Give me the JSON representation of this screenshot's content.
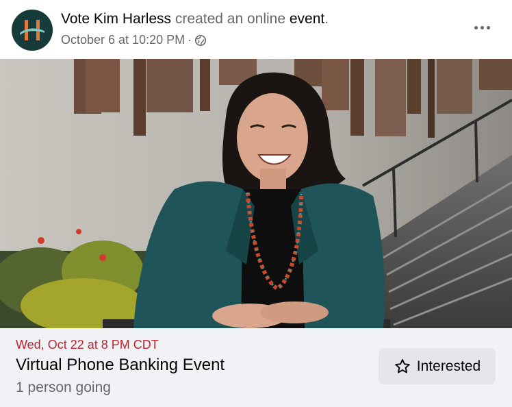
{
  "post": {
    "author": "Vote Kim Harless",
    "action_text": "created an online",
    "object": "event",
    "punct": ".",
    "date": "October 6 at 10:20 PM",
    "separator": "·",
    "audience_icon": "globe-icon",
    "more_icon": "more-horizontal-icon"
  },
  "avatar": {
    "letter": "H"
  },
  "event": {
    "datetime": "Wed, Oct 22 at 8 PM CDT",
    "title": "Virtual Phone Banking Event",
    "going": "1 person going",
    "interested_label": "Interested",
    "interested_icon": "star-outline-icon"
  },
  "colors": {
    "date_red": "#c0232e",
    "button_bg": "#e4e6eb",
    "info_bg": "#f0f2f5",
    "avatar_bg": "#173b3a",
    "avatar_accent": "#e07a3f"
  }
}
